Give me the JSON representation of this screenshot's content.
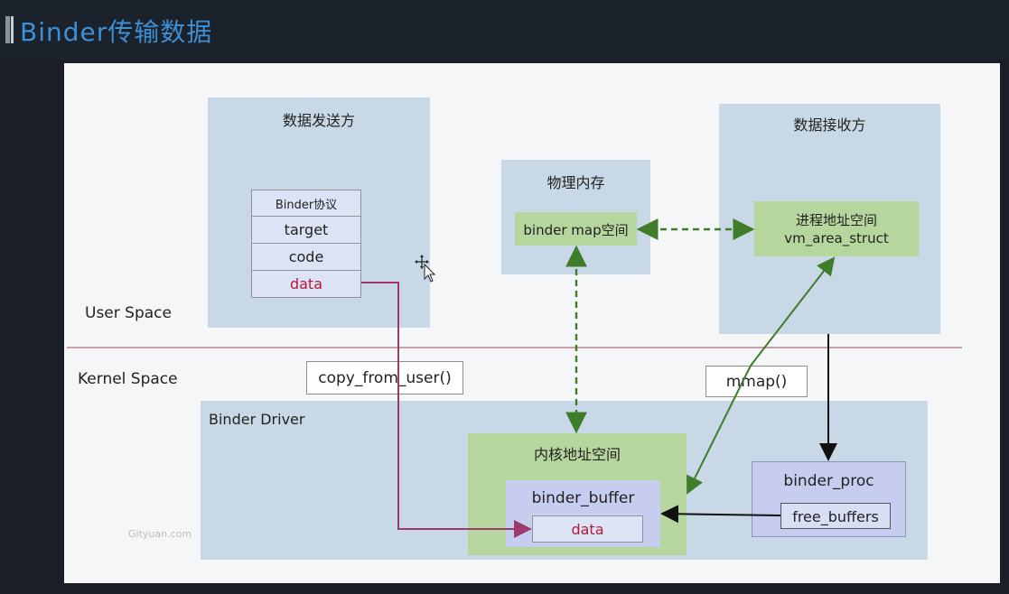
{
  "title": "Binder传输数据",
  "regions": {
    "user_space": "User Space",
    "kernel_space": "Kernel Space"
  },
  "sender": {
    "title": "数据发送方",
    "protocol_header": "Binder协议",
    "rows": [
      "target",
      "code",
      "data"
    ]
  },
  "physical_memory": {
    "title": "物理内存",
    "map": "binder map空间"
  },
  "receiver": {
    "title": "数据接收方",
    "vm_line1": "进程地址空间",
    "vm_line2": "vm_area_struct"
  },
  "calls": {
    "copy": "copy_from_user()",
    "mmap": "mmap()"
  },
  "driver": {
    "title": "Binder Driver",
    "kernel_addr_space": "内核地址空间",
    "buffer": "binder_buffer",
    "buffer_data": "data",
    "proc": "binder_proc",
    "free_buffers": "free_buffers"
  },
  "watermark": "Gityuan.com",
  "colors": {
    "title": "#3d8fd6",
    "pale_blue": "#c9d8e6",
    "green": "#b5d69c",
    "lavender": "#c6cdef",
    "data_red": "#b8183a",
    "copy_arrow": "#9c3a6a",
    "green_arrow": "#3f7d2b",
    "separator": "#c8a0a8"
  },
  "icons": [
    "move-cursor-icon"
  ]
}
